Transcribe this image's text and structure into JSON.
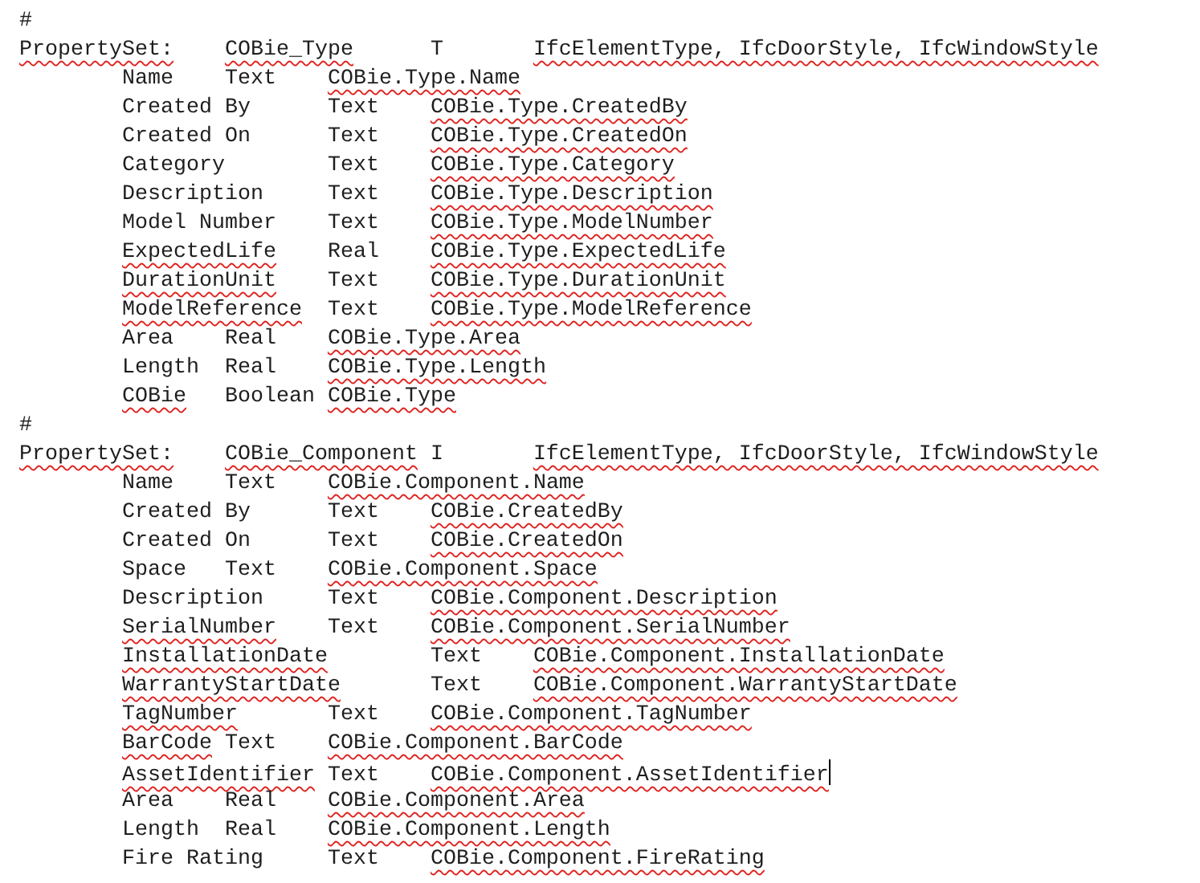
{
  "lines": [
    {
      "kind": "separator",
      "fields": [
        {
          "text": "#",
          "flagged": false
        }
      ]
    },
    {
      "kind": "header",
      "fields": [
        {
          "text": "PropertySet:",
          "flagged": true
        },
        {
          "text": "COBie_Type",
          "flagged": true
        },
        {
          "text": "T",
          "flagged": false
        },
        {
          "text": "IfcElementType, IfcDoorStyle, IfcWindowStyle",
          "flagged": true
        }
      ]
    },
    {
      "kind": "property",
      "fields": [
        {
          "text": "Name",
          "flagged": false
        },
        {
          "text": "Text",
          "flagged": false
        },
        {
          "text": "COBie.Type.Name",
          "flagged": true
        }
      ]
    },
    {
      "kind": "property",
      "fields": [
        {
          "text": "Created By",
          "flagged": false
        },
        {
          "text": "Text",
          "flagged": false
        },
        {
          "text": "COBie.Type.CreatedBy",
          "flagged": true
        }
      ]
    },
    {
      "kind": "property",
      "fields": [
        {
          "text": "Created On",
          "flagged": false
        },
        {
          "text": "Text",
          "flagged": false
        },
        {
          "text": "COBie.Type.CreatedOn",
          "flagged": true
        }
      ]
    },
    {
      "kind": "property",
      "fields": [
        {
          "text": "Category",
          "flagged": false
        },
        {
          "text": "Text",
          "flagged": false
        },
        {
          "text": "COBie.Type.Category",
          "flagged": true
        }
      ]
    },
    {
      "kind": "property",
      "fields": [
        {
          "text": "Description",
          "flagged": false
        },
        {
          "text": "Text",
          "flagged": false
        },
        {
          "text": "COBie.Type.Description",
          "flagged": true
        }
      ]
    },
    {
      "kind": "property",
      "fields": [
        {
          "text": "Model Number",
          "flagged": false
        },
        {
          "text": "Text",
          "flagged": false
        },
        {
          "text": "COBie.Type.ModelNumber",
          "flagged": true
        }
      ]
    },
    {
      "kind": "property",
      "fields": [
        {
          "text": "ExpectedLife",
          "flagged": true
        },
        {
          "text": "Real",
          "flagged": false
        },
        {
          "text": "COBie.Type.ExpectedLife",
          "flagged": true
        }
      ]
    },
    {
      "kind": "property",
      "fields": [
        {
          "text": "DurationUnit",
          "flagged": true
        },
        {
          "text": "Text",
          "flagged": false
        },
        {
          "text": "COBie.Type.DurationUnit",
          "flagged": true
        }
      ]
    },
    {
      "kind": "property",
      "fields": [
        {
          "text": "ModelReference",
          "flagged": true
        },
        {
          "text": "Text",
          "flagged": false
        },
        {
          "text": "COBie.Type.ModelReference",
          "flagged": true
        }
      ]
    },
    {
      "kind": "property",
      "fields": [
        {
          "text": "Area",
          "flagged": false
        },
        {
          "text": "Real",
          "flagged": false
        },
        {
          "text": "COBie.Type.Area",
          "flagged": true
        }
      ]
    },
    {
      "kind": "property",
      "fields": [
        {
          "text": "Length",
          "flagged": false
        },
        {
          "text": "Real",
          "flagged": false
        },
        {
          "text": "COBie.Type.Length",
          "flagged": true
        }
      ]
    },
    {
      "kind": "property",
      "fields": [
        {
          "text": "COBie",
          "flagged": true
        },
        {
          "text": "Boolean",
          "flagged": false
        },
        {
          "text": "COBie.Type",
          "flagged": true
        }
      ]
    },
    {
      "kind": "separator",
      "fields": [
        {
          "text": "#",
          "flagged": false
        }
      ]
    },
    {
      "kind": "header",
      "fields": [
        {
          "text": "PropertySet:",
          "flagged": true
        },
        {
          "text": "COBie_Component",
          "flagged": true
        },
        {
          "text": "I",
          "flagged": false
        },
        {
          "text": "IfcElementType, IfcDoorStyle, IfcWindowStyle",
          "flagged": true
        }
      ]
    },
    {
      "kind": "property",
      "fields": [
        {
          "text": "Name",
          "flagged": false
        },
        {
          "text": "Text",
          "flagged": false
        },
        {
          "text": "COBie.Component.Name",
          "flagged": true
        }
      ]
    },
    {
      "kind": "property",
      "fields": [
        {
          "text": "Created By",
          "flagged": false
        },
        {
          "text": "Text",
          "flagged": false
        },
        {
          "text": "COBie.CreatedBy",
          "flagged": true
        }
      ]
    },
    {
      "kind": "property",
      "fields": [
        {
          "text": "Created On",
          "flagged": false
        },
        {
          "text": "Text",
          "flagged": false
        },
        {
          "text": "COBie.CreatedOn",
          "flagged": true
        }
      ]
    },
    {
      "kind": "property",
      "fields": [
        {
          "text": "Space",
          "flagged": false
        },
        {
          "text": "Text",
          "flagged": false
        },
        {
          "text": "COBie.Component.Space",
          "flagged": true
        }
      ]
    },
    {
      "kind": "property",
      "fields": [
        {
          "text": "Description",
          "flagged": false
        },
        {
          "text": "Text",
          "flagged": false
        },
        {
          "text": "COBie.Component.Description",
          "flagged": true
        }
      ]
    },
    {
      "kind": "property",
      "fields": [
        {
          "text": "SerialNumber",
          "flagged": true
        },
        {
          "text": "Text",
          "flagged": false
        },
        {
          "text": "COBie.Component.SerialNumber",
          "flagged": true
        }
      ]
    },
    {
      "kind": "property",
      "fields": [
        {
          "text": "InstallationDate",
          "flagged": true
        },
        {
          "text": "Text",
          "flagged": false
        },
        {
          "text": "COBie.Component.InstallationDate",
          "flagged": true
        }
      ]
    },
    {
      "kind": "property",
      "fields": [
        {
          "text": "WarrantyStartDate",
          "flagged": true
        },
        {
          "text": "Text",
          "flagged": false
        },
        {
          "text": "COBie.Component.WarrantyStartDate",
          "flagged": true
        }
      ]
    },
    {
      "kind": "property",
      "fields": [
        {
          "text": "TagNumber",
          "flagged": true
        },
        {
          "text": "Text",
          "flagged": false
        },
        {
          "text": "COBie.Component.TagNumber",
          "flagged": true
        }
      ]
    },
    {
      "kind": "property",
      "fields": [
        {
          "text": "BarCode",
          "flagged": true
        },
        {
          "text": "Text",
          "flagged": false
        },
        {
          "text": "COBie.Component.BarCode",
          "flagged": true
        }
      ]
    },
    {
      "kind": "property",
      "cursor": true,
      "fields": [
        {
          "text": "AssetIdentifier",
          "flagged": true
        },
        {
          "text": "Text",
          "flagged": false
        },
        {
          "text": "COBie.Component.AssetIdentifier",
          "flagged": true
        }
      ]
    },
    {
      "kind": "property",
      "fields": [
        {
          "text": "Area",
          "flagged": false
        },
        {
          "text": "Real",
          "flagged": false
        },
        {
          "text": "COBie.Component.Area",
          "flagged": true
        }
      ]
    },
    {
      "kind": "property",
      "fields": [
        {
          "text": "Length",
          "flagged": false
        },
        {
          "text": "Real",
          "flagged": false
        },
        {
          "text": "COBie.Component.Length",
          "flagged": true
        }
      ]
    },
    {
      "kind": "property",
      "fields": [
        {
          "text": "Fire Rating",
          "flagged": false
        },
        {
          "text": "Text",
          "flagged": false
        },
        {
          "text": "COBie.Component.FireRating",
          "flagged": true
        }
      ]
    }
  ]
}
